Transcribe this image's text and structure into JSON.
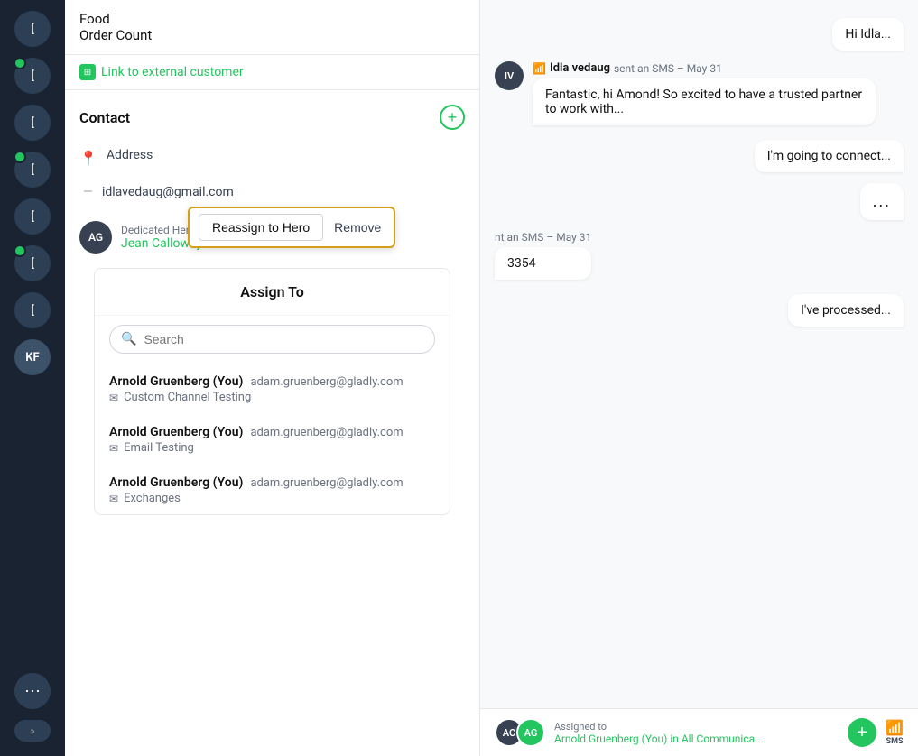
{
  "sidebar": {
    "avatars": [
      {
        "initials": "[",
        "has_dot": false
      },
      {
        "initials": "[",
        "has_dot": true
      },
      {
        "initials": "[",
        "has_dot": false
      },
      {
        "initials": "[",
        "has_dot": true
      },
      {
        "initials": "[",
        "has_dot": false
      },
      {
        "initials": "[",
        "has_dot": true
      },
      {
        "initials": "[",
        "has_dot": false
      },
      {
        "initials": "KF",
        "has_dot": false,
        "special": "kf"
      }
    ],
    "expand_label": "»",
    "dots_label": "⋯"
  },
  "left_panel": {
    "food_label": "Food",
    "order_count_label": "Order Count",
    "link_text": "Link to external customer",
    "contact": {
      "title": "Contact",
      "add_label": "+",
      "address_label": "Address",
      "email": "idlavedaug@gmail.com",
      "dedicated_hero": {
        "initials": "AG",
        "label": "Dedicated Hero",
        "name": "Jean Calloway in All Commu..."
      }
    },
    "actions": {
      "reassign_label": "Reassign to Hero",
      "remove_label": "Remove"
    },
    "assign_to": {
      "title": "Assign To",
      "search_placeholder": "Search",
      "agents": [
        {
          "name": "Arnold Gruenberg (You)",
          "email": "adam.gruenberg@gladly.com",
          "channel": "Custom Channel Testing"
        },
        {
          "name": "Arnold Gruenberg (You)",
          "email": "adam.gruenberg@gladly.com",
          "channel": "Email Testing"
        },
        {
          "name": "Arnold Gruenberg (You)",
          "email": "adam.gruenberg@gladly.com",
          "channel": "Exchanges"
        }
      ]
    }
  },
  "chat": {
    "messages": [
      {
        "type": "right",
        "text": "Hi Idla..."
      },
      {
        "type": "left_system",
        "avatar": "IV",
        "sender": "Idla vedaug",
        "meta": "sent an SMS – May 31",
        "text": "Fantastic, hi Amond! So excited to have a trusted partner to work with..."
      },
      {
        "type": "right",
        "text": "I'm going to connect..."
      },
      {
        "type": "right",
        "text": "..."
      },
      {
        "type": "left_system_partial",
        "meta": "nt an SMS – May 31",
        "text": "3354"
      },
      {
        "type": "right",
        "text": "I've processed..."
      }
    ],
    "bottom_bar": {
      "avatar1": "AC",
      "avatar2": "AG",
      "assigned_label": "Assigned to",
      "assigned_name": "Arnold Gruenberg (You) in All Communica...",
      "add_label": "+",
      "sms_label": "SMS"
    }
  }
}
